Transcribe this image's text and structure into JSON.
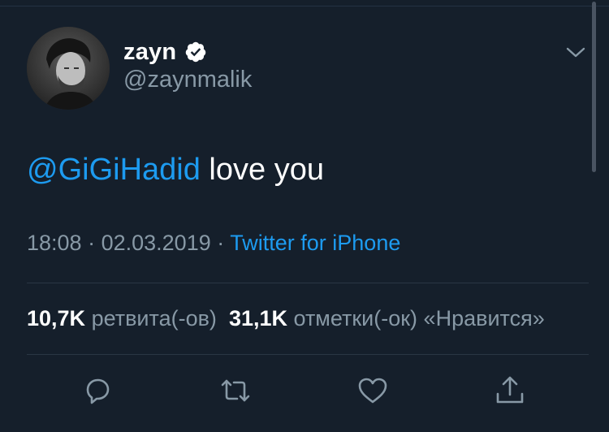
{
  "tweet": {
    "display_name": "zayn",
    "handle": "@zaynmalik",
    "mention": "@GiGiHadid",
    "text": " love you",
    "time": "18:08",
    "date": "02.03.2019",
    "source": "Twitter for iPhone"
  },
  "stats": {
    "retweets_count": "10,7K",
    "retweets_label": "ретвита(-ов)",
    "likes_count": "31,1K",
    "likes_label": "отметки(-ок) «Нравится»"
  },
  "icons": {
    "verified": "verified-badge-icon",
    "menu": "chevron-down-icon",
    "reply": "reply-icon",
    "retweet": "retweet-icon",
    "like": "heart-icon",
    "share": "share-icon"
  },
  "colors": {
    "background": "#151f2b",
    "accent": "#1d9bf0",
    "secondary_text": "#8899a6",
    "primary_text": "#ffffff"
  }
}
